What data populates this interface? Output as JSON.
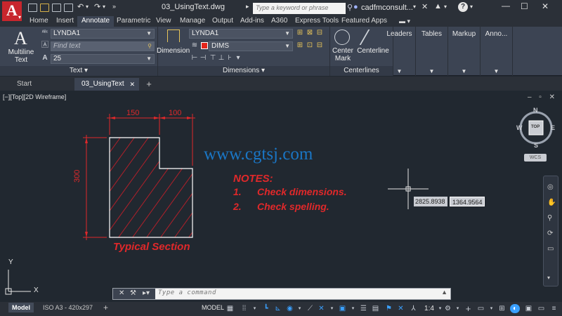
{
  "app": {
    "title": "03_UsingText.dwg",
    "search_placeholder": "Type a keyword or phrase",
    "user_name": "cadfmconsult...",
    "logo_letter": "A",
    "colors": {
      "accent": "#c8262d",
      "background": "#212830",
      "ribbon": "#3c4453",
      "annotation": "#e02a1f",
      "hatch": "#b0202a",
      "geometry": "#ffffff",
      "ucs_blue": "#1e6fd9"
    }
  },
  "ribbon_tabs": [
    "Home",
    "Insert",
    "Annotate",
    "Parametric",
    "View",
    "Manage",
    "Output",
    "Add-ins",
    "A360",
    "Express Tools",
    "Featured Apps"
  ],
  "active_tab": "Annotate",
  "text_panel": {
    "multiline_label_1": "Multiline",
    "multiline_label_2": "Text",
    "style_value": "LYNDA1",
    "find_placeholder": "Find text",
    "height_value": "25",
    "title": "Text"
  },
  "dimensions_panel": {
    "dimension_label": "Dimension",
    "style_value": "LYNDA1",
    "layer_value": "DIMS",
    "title": "Dimensions"
  },
  "centerlines_panel": {
    "center_mark_1": "Center",
    "center_mark_2": "Mark",
    "centerline": "Centerline",
    "title": "Centerlines"
  },
  "collapsed_panels": [
    "Leaders",
    "Tables",
    "Markup",
    "Anno..."
  ],
  "file_tabs": [
    "Start",
    "03_UsingText"
  ],
  "viewport": {
    "label": "[−][Top][2D Wireframe]",
    "viewcube_top": "TOP",
    "viewcube_n": "N",
    "viewcube_s": "S",
    "viewcube_e": "E",
    "viewcube_w": "W",
    "wcs": "WCS"
  },
  "drawing": {
    "dim_top_left": "150",
    "dim_top_right": "100",
    "dim_left": "300",
    "caption": "Typical Section",
    "notes_title": "NOTES:",
    "note_1_num": "1.",
    "note_1": "Check dimensions.",
    "note_2_num": "2.",
    "note_2": "Check spelling.",
    "watermark": "www.cgtsj.com",
    "coord_x": "2825.8938",
    "coord_y": "1364.9564",
    "ucs_x": "X",
    "ucs_y": "Y"
  },
  "command_line": {
    "placeholder": "Type a command"
  },
  "layout_tabs": [
    "Model",
    "ISO A3 - 420x297"
  ],
  "status_bar": {
    "model": "MODEL",
    "scale": "1:4"
  }
}
